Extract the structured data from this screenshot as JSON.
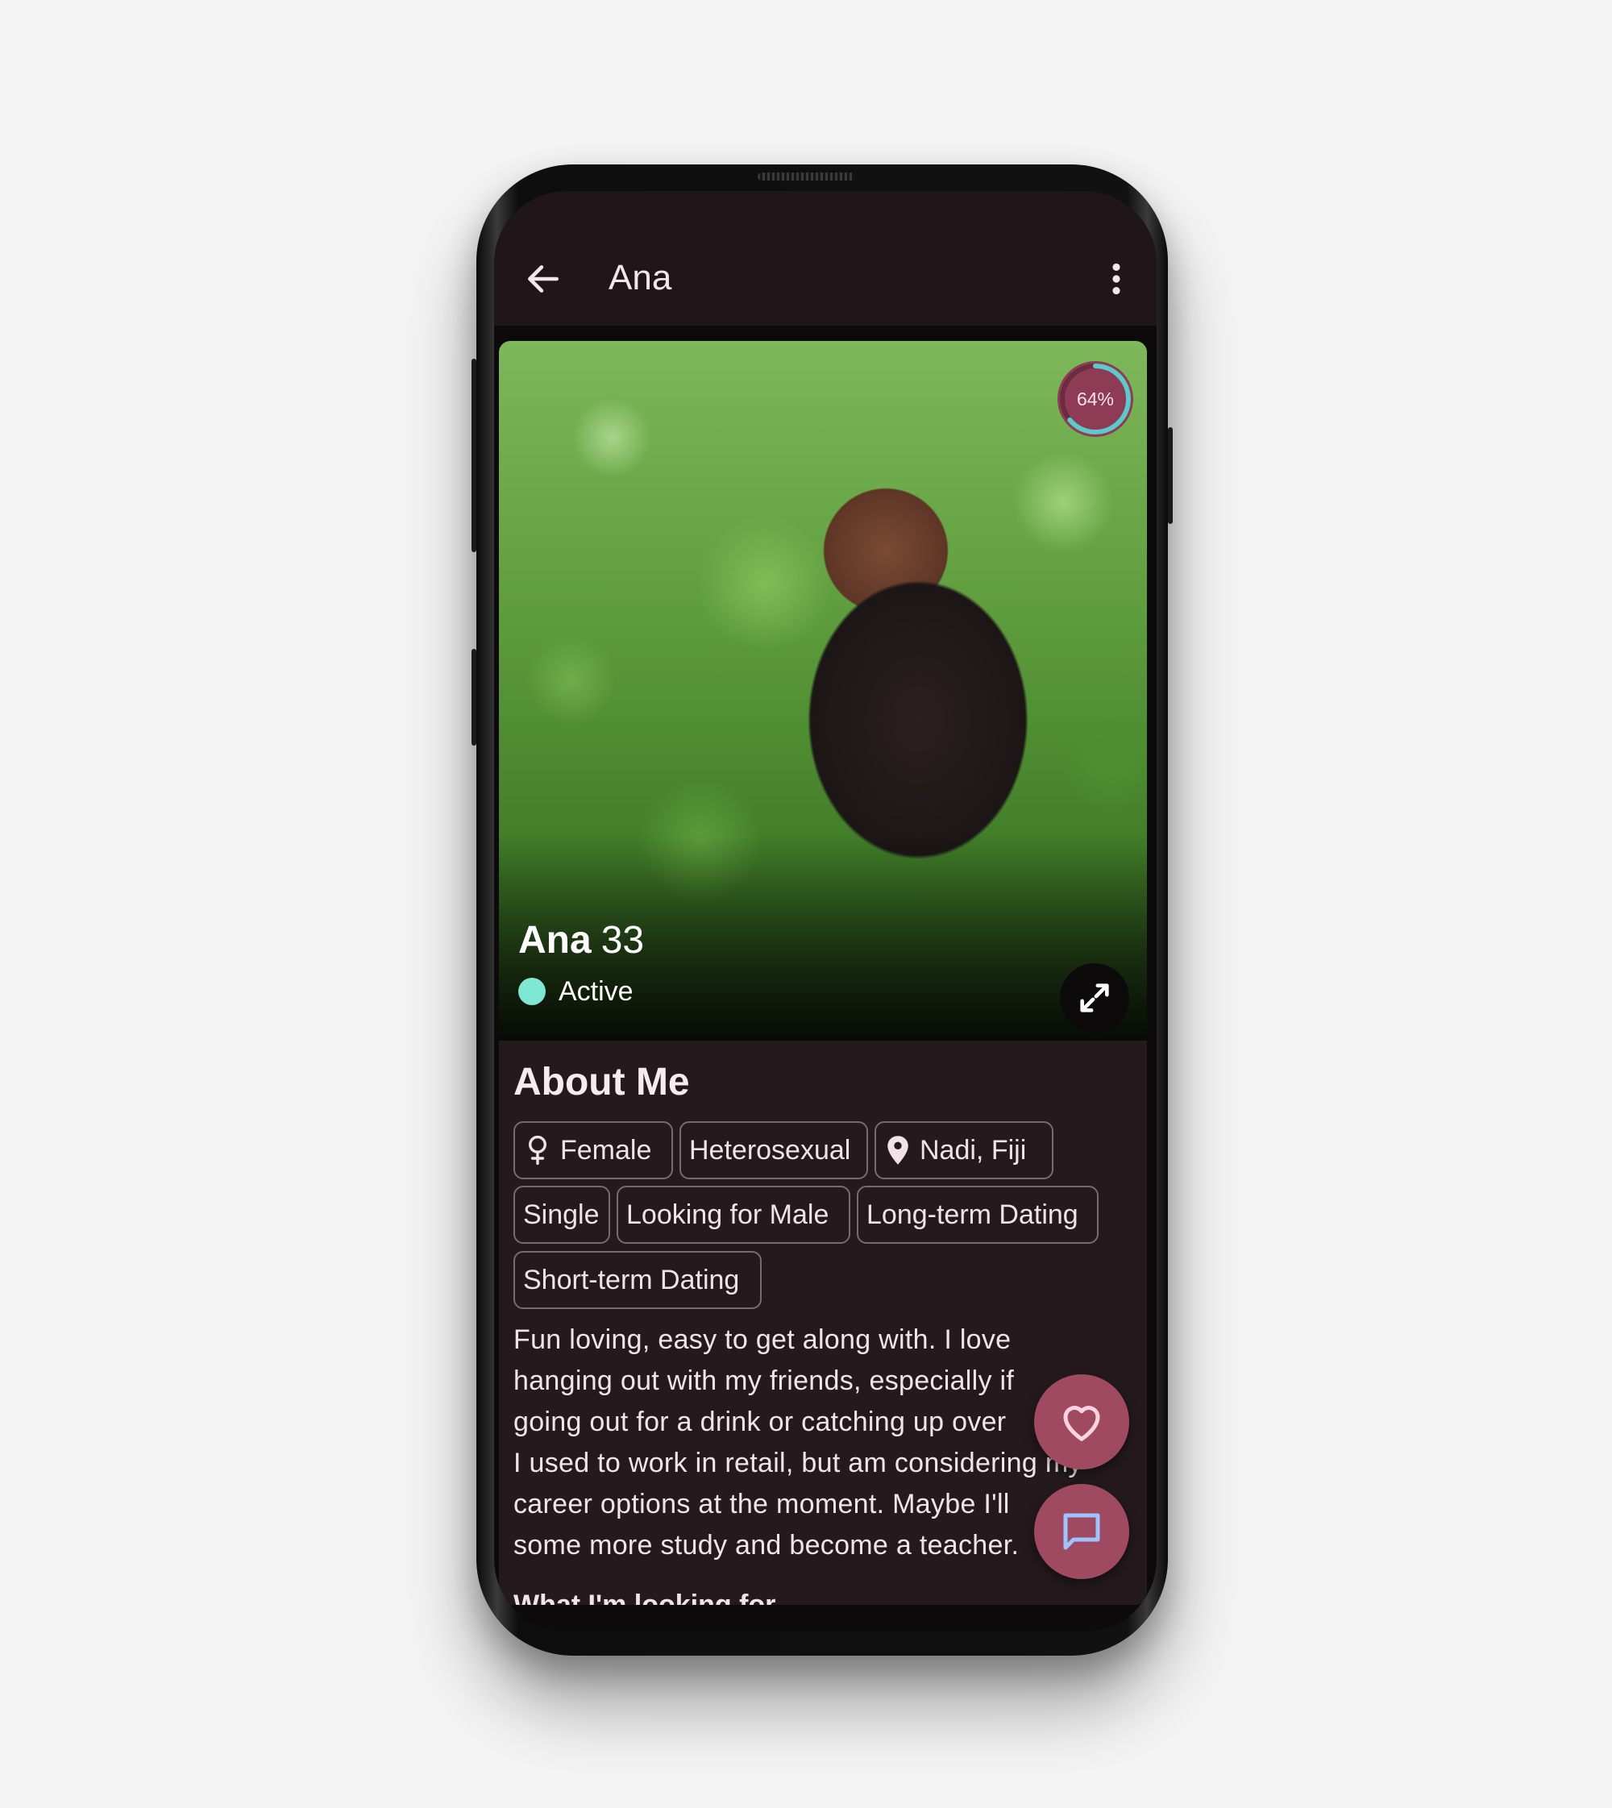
{
  "app_bar": {
    "title": "Ana",
    "back_icon": "arrow-left-icon",
    "menu_icon": "more-vertical-icon"
  },
  "profile": {
    "name": "Ana",
    "age": "33",
    "status": "Active",
    "status_color": "#7ee8d2",
    "match_percent_label": "64%",
    "match_fraction": 0.64,
    "expand_icon": "expand-diagonal-icon"
  },
  "about": {
    "title": "About Me",
    "chips": [
      {
        "label": "Female",
        "icon": "female-symbol-icon"
      },
      {
        "label": "Heterosexual"
      },
      {
        "label": "Nadi, Fiji",
        "icon": "map-pin-icon"
      },
      {
        "label": "Single"
      },
      {
        "label": "Looking for Male"
      },
      {
        "label": "Long-term Dating"
      },
      {
        "label": "Short-term Dating"
      }
    ],
    "bio_lines": [
      "Fun loving, easy to get along with. I love",
      "hanging out with my friends, especially if",
      "going out for a drink or catching up over",
      "I used to work in retail, but am considering my",
      "career options at the moment. Maybe I'll",
      "some more study and become a teacher."
    ],
    "next_heading": "What I'm looking for"
  },
  "actions": {
    "like_icon": "heart-icon",
    "message_icon": "chat-bubble-icon"
  },
  "colors": {
    "app_bar_bg": "#201619",
    "card_bg": "#241a1d",
    "accent": "#a04a62",
    "ring": "#5ec9c9"
  }
}
